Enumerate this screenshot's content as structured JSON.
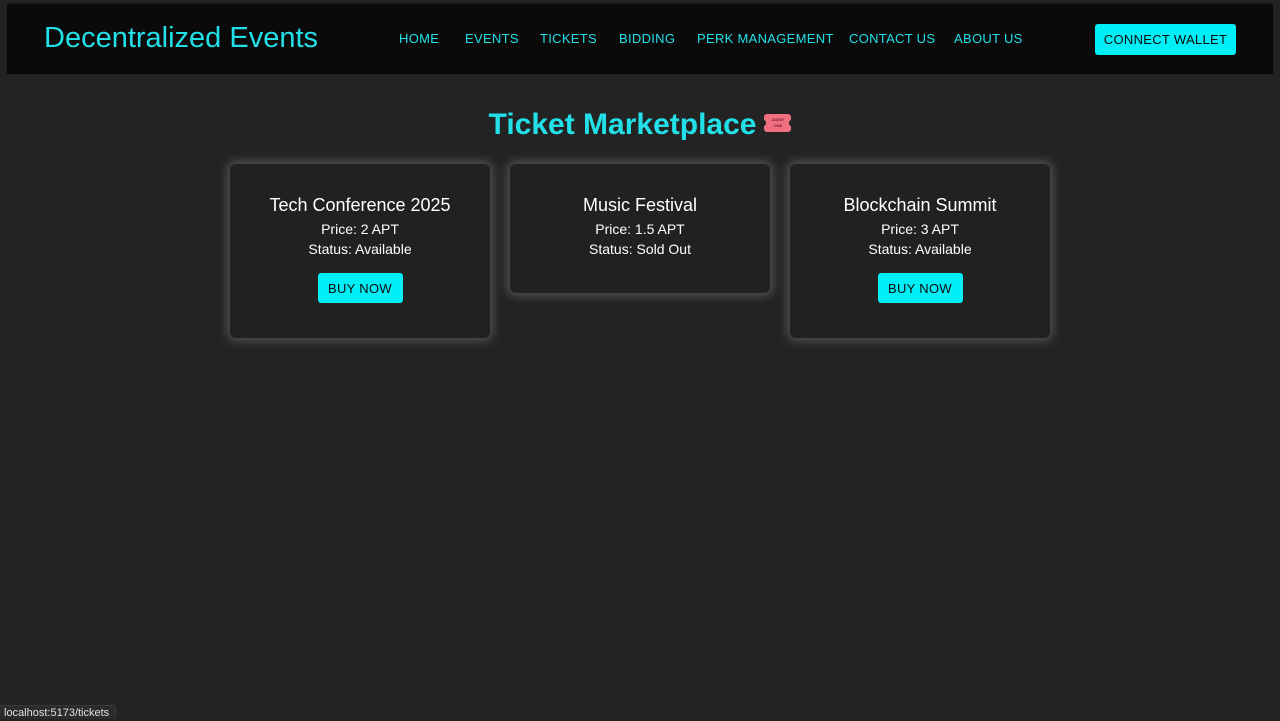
{
  "header": {
    "brand": "Decentralized Events",
    "nav": [
      {
        "label": "HOME"
      },
      {
        "label": "EVENTS"
      },
      {
        "label": "TICKETS"
      },
      {
        "label": "BIDDING"
      },
      {
        "label": "PERK MANAGEMENT"
      },
      {
        "label": "CONTACT US"
      },
      {
        "label": "ABOUT US"
      }
    ],
    "connect_label": "CONNECT WALLET"
  },
  "main": {
    "title": "Ticket Marketplace",
    "title_icon": "admission-ticket-icon",
    "tickets": [
      {
        "name": "Tech Conference 2025",
        "price": "Price: 2 APT",
        "status": "Status: Available",
        "button": "BUY NOW"
      },
      {
        "name": "Music Festival",
        "price": "Price: 1.5 APT",
        "status": "Status: Sold Out"
      },
      {
        "name": "Blockchain Summit",
        "price": "Price: 3 APT",
        "status": "Status: Available",
        "button": "BUY NOW"
      }
    ]
  },
  "status_bar": {
    "url": "localhost:5173/tickets"
  },
  "colors": {
    "accent": "#22e0e8",
    "button_bg": "#00eef5",
    "page_bg": "#232323",
    "navbar_bg": "#0a0a0a",
    "card_bg": "#212121"
  }
}
